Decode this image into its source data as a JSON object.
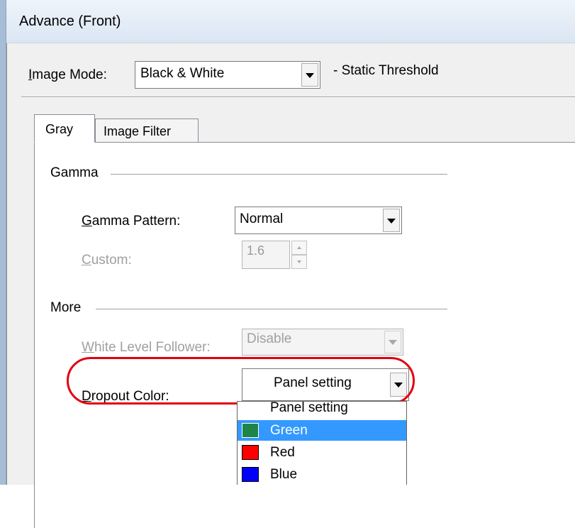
{
  "window": {
    "title": "Advance (Front)"
  },
  "header": {
    "image_mode_label_key": "I",
    "image_mode_label_rest": "mage Mode:",
    "image_mode_value": "Black & White",
    "threshold_text": "- Static Threshold"
  },
  "tabs": [
    {
      "label": "Gray",
      "active": true
    },
    {
      "label": "Image Filter",
      "active": false
    }
  ],
  "gamma": {
    "group_label": "Gamma",
    "pattern_label_key": "G",
    "pattern_label_rest": "amma Pattern:",
    "pattern_value": "Normal",
    "custom_label_key": "C",
    "custom_label_rest": "ustom:",
    "custom_value": "1.6"
  },
  "more": {
    "group_label": "More",
    "wlf_label_key": "W",
    "wlf_label_rest": "hite Level Follower:",
    "wlf_value": "Disable",
    "dropout_label_key": "D",
    "dropout_label_rest": "ropout Color:",
    "dropout_value": "Panel setting",
    "dropout_options": [
      {
        "label": "Panel setting",
        "color": null
      },
      {
        "label": "Green",
        "color": "#1e8449",
        "selected": true
      },
      {
        "label": "Red",
        "color": "#ff0000"
      },
      {
        "label": "Blue",
        "color": "#0000ff"
      }
    ]
  },
  "colors": {
    "highlight": "#e10010",
    "selection": "#3399ff"
  }
}
